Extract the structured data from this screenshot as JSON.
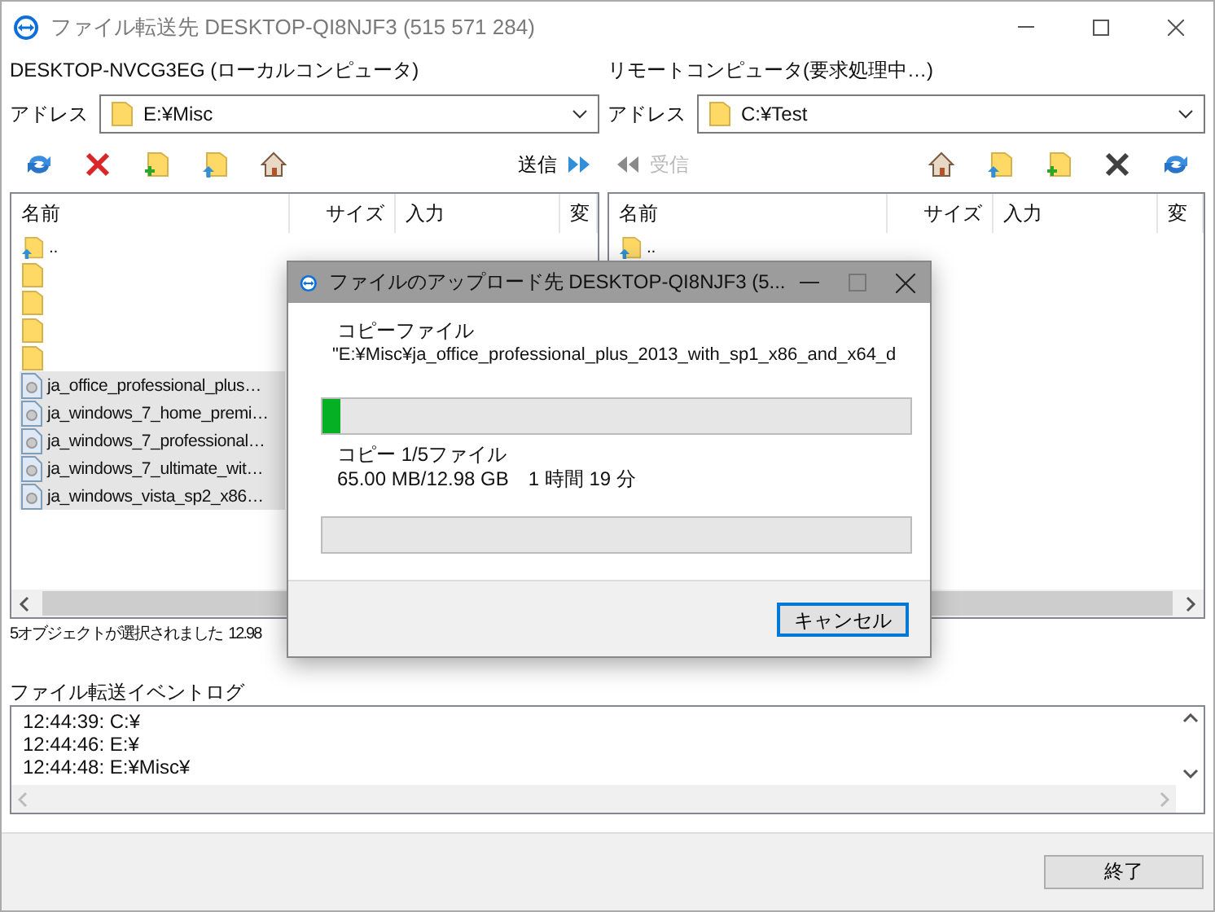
{
  "window": {
    "title": "ファイル転送先 DESKTOP-QI8NJF3 (515 571 284)"
  },
  "panes": [
    {
      "kind": "local",
      "heading": "DESKTOP-NVCG3EG (ローカルコンピュータ)",
      "address_label": "アドレス",
      "address": "E:¥Misc",
      "transfer": {
        "label": "送信",
        "disabled": false
      },
      "columns": [
        "名前",
        "サイズ",
        "入力",
        "変"
      ],
      "rows": [
        {
          "kind": "parent",
          "name": "..",
          "selected": false
        },
        {
          "kind": "folder",
          "selected": false
        },
        {
          "kind": "folder",
          "selected": false
        },
        {
          "kind": "folder",
          "selected": false
        },
        {
          "kind": "folder",
          "selected": false
        },
        {
          "kind": "file",
          "name": "ja_office_professional_plus…",
          "selected": true
        },
        {
          "kind": "file",
          "name": "ja_windows_7_home_premi…",
          "selected": true
        },
        {
          "kind": "file",
          "name": "ja_windows_7_professional…",
          "selected": true
        },
        {
          "kind": "file",
          "name": "ja_windows_7_ultimate_wit…",
          "selected": true
        },
        {
          "kind": "file",
          "name": "ja_windows_vista_sp2_x86…",
          "selected": true
        }
      ],
      "status": "5オブジェクトが選択されました  12.98"
    },
    {
      "kind": "remote",
      "heading": "リモートコンピュータ(要求処理中…)",
      "address_label": "アドレス",
      "address": "C:¥Test",
      "transfer": {
        "label": "受信",
        "disabled": true
      },
      "columns": [
        "名前",
        "サイズ",
        "入力",
        "変"
      ],
      "rows": [
        {
          "kind": "parent",
          "name": "..",
          "selected": false
        }
      ]
    }
  ],
  "log": {
    "label": "ファイル転送イベントログ",
    "entries": [
      "12:44:39: C:¥",
      "12:44:46: E:¥",
      "12:44:48: E:¥Misc¥"
    ]
  },
  "close_button": "終了",
  "dialog": {
    "title": "ファイルのアップロード先 DESKTOP-QI8NJF3 (5...",
    "file_label": "コピーファイル",
    "path": "\"E:¥Misc¥ja_office_professional_plus_2013_with_sp1_x86_and_x64_d",
    "file_progress": {
      "level": 0.03
    },
    "count": "コピー 1/5ファイル",
    "size": "65.00 MB/12.98 GB",
    "time": "1 時間 19 分",
    "total_progress": {
      "level": 0
    },
    "cancel": "キャンセル"
  }
}
